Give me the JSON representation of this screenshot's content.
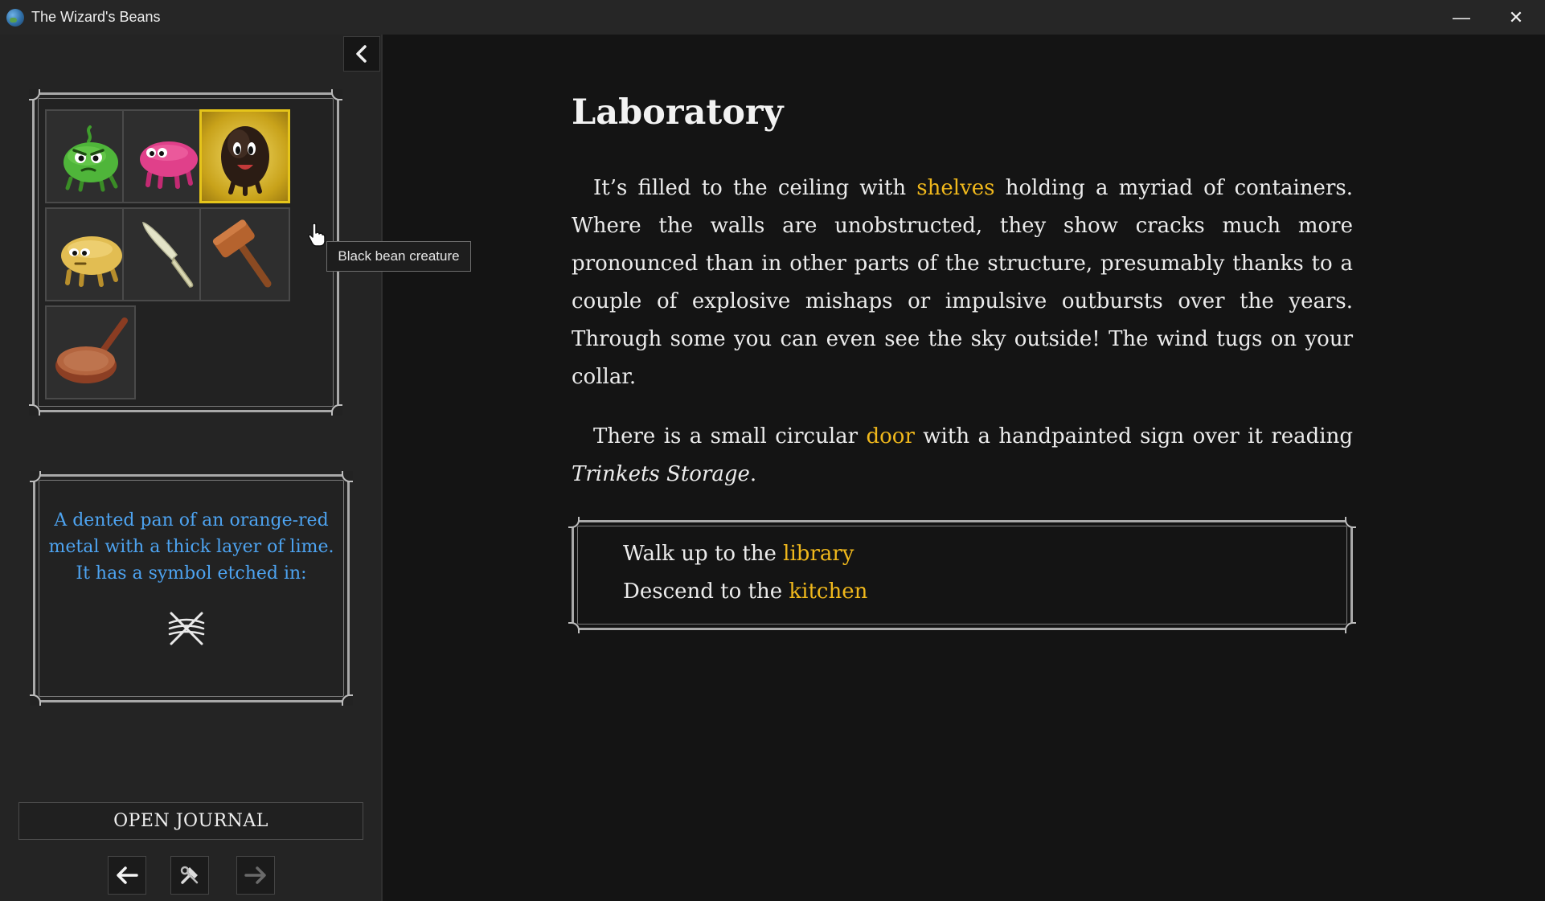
{
  "window": {
    "title": "The Wizard's Beans",
    "minimize_glyph": "—",
    "close_glyph": "✕"
  },
  "sidebar": {
    "inventory": [
      {
        "name": "green-bean-creature-icon"
      },
      {
        "name": "pink-bean-creature-icon"
      },
      {
        "name": "black-bean-creature-icon",
        "selected": true
      },
      {
        "name": "yellow-bean-creature-icon"
      },
      {
        "name": "knife-icon"
      },
      {
        "name": "mallet-icon"
      },
      {
        "name": "frying-pan-icon"
      }
    ],
    "tooltip": "Black bean creature",
    "description": "A dented pan of an orange-red metal with a thick layer of lime. It has a symbol etched in:",
    "journal_label": "OPEN JOURNAL"
  },
  "scene": {
    "title": "Laboratory",
    "p1": {
      "before": "It’s filled to the ceiling with ",
      "link": "shelves",
      "after": " holding a myriad of containers. Where the walls are unobstructed, they show cracks much more pronounced than in other parts of the structure, presumably thanks to a couple of explosive mishaps or impulsive outbursts over the years. Through some you can even see the sky outside! The wind tugs on your collar."
    },
    "p2": {
      "before": "There is a small circular ",
      "link": "door",
      "middle": " with a handpainted sign over it reading ",
      "italic": "Trinkets Storage",
      "after": "."
    },
    "choices": [
      {
        "prefix": "Walk up to the ",
        "link": "library"
      },
      {
        "prefix": "Descend to the ",
        "link": "kitchen"
      }
    ]
  },
  "colors": {
    "highlight": "#f0b81c",
    "description_text": "#4da3f0",
    "selected_slot": "#e6c51a"
  }
}
